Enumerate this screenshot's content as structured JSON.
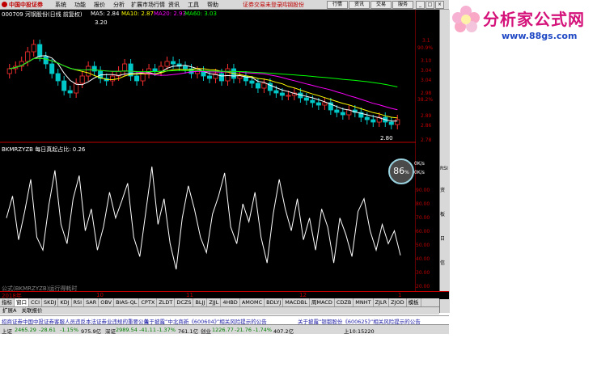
{
  "menubar": {
    "logo": "中国中投证券",
    "items": [
      "系统",
      "功能",
      "报价",
      "分析",
      "扩展市场行情",
      "资讯",
      "工具",
      "帮助"
    ],
    "notice": "证券交易未登录",
    "stock_link": "鸿钢股份",
    "buttons": [
      "行情",
      "资讯",
      "交易",
      "服务"
    ]
  },
  "main_info": {
    "code_name": "000709 河钢股份(日线 前复权)",
    "ma5": "MA5: 2.84",
    "ma10": "MA10: 2.87",
    "ma20": "MA20: 2.93",
    "ma60": "MA60: 3.03",
    "high_label": "3.20",
    "low_label": "2.80"
  },
  "price_axis": {
    "ticks": [
      "3.1",
      "90.9%",
      "3.10",
      "3.04",
      "3.04",
      "2.98",
      "38.2%",
      "2.89",
      "2.86",
      "2.78"
    ]
  },
  "indicator": {
    "title": "BKMRZYZB 每日真起占比: 0.26",
    "formula_label": "公式(BKMRZYZB)运行得耗时",
    "ticks": [
      "100.00",
      "90.00",
      "80.00",
      "70.00",
      "60.00",
      "50.00",
      "40.00",
      "30.00",
      "20.00",
      "10.00"
    ],
    "gauge_value": "86",
    "gauge_unit": "%",
    "net_up": "0K/s",
    "net_down": "0K/s",
    "month_labels": [
      "10",
      "11",
      "12"
    ],
    "year_label": "2018年",
    "last_label": "1"
  },
  "tab_bar": {
    "tabs": [
      "指标",
      "窗口",
      "CCI",
      "SKDJ",
      "KDJ",
      "RSI",
      "SAR",
      "OBV",
      "BIAS-QL",
      "CPTX",
      "ZLDT",
      "DCZS",
      "BLJJ",
      "ZJJL",
      "4HBD",
      "AMOMC",
      "BDLYJ",
      "MACDBL",
      "周MACD",
      "CDZB",
      "MNHT",
      "ZJLR",
      "ZJOD",
      "模板"
    ]
  },
  "subtab_bar": {
    "tabs": [
      "扩展A",
      "关联报价"
    ]
  },
  "news": [
    "招商证券中国中投证券客服人员违反本法证券业违规的重要公告",
    "关于披露“中北商新《600604》”相关风险提示的公告",
    "关于披露“银都股份《600625》”相关风险提示的公告"
  ],
  "status_bar": {
    "sh_label": "上证",
    "sh_value": "2465.29",
    "sh_change": "-28.61",
    "sh_pct": "-1.15%",
    "sh_amount": "975.9亿",
    "sz_label": "深证",
    "sz_value": "2989.54",
    "sz_change": "-41.11",
    "sz_pct": "-1.37%",
    "sz_amount": "761.1亿",
    "cy_label": "创业",
    "cy_value": "1226.77",
    "cy_change": "-21.76",
    "cy_pct": "-1.74%",
    "cy_amount": "407.2亿",
    "server": "上10:15220"
  },
  "right_strip": {
    "labels": [
      "RSI",
      "资",
      "板",
      "日",
      "信"
    ]
  },
  "watermark": {
    "text": "分析家公式网",
    "url": "www.88gs.com"
  },
  "colors": {
    "up": "#ff3030",
    "down": "#00c8c8",
    "ma5": "#ffffff",
    "ma10": "#ffff00",
    "ma20": "#ff00ff",
    "ma60": "#00ff00",
    "indicator_line": "#ffffff",
    "brand": "#d4127a",
    "url": "#1f48c4"
  },
  "chart_data": [
    {
      "type": "candlestick",
      "title": "000709 河钢股份(日线 前复权)",
      "ylim": [
        2.76,
        3.24
      ],
      "close": [
        3.05,
        3.06,
        3.08,
        3.12,
        3.15,
        3.1,
        3.07,
        3.03,
        3.0,
        2.96,
        2.95,
        2.99,
        3.02,
        3.06,
        3.04,
        3.01,
        3.0,
        3.02,
        3.04,
        3.07,
        3.02,
        3.0,
        3.03,
        3.05,
        3.04,
        3.06,
        3.08,
        3.07,
        3.06,
        3.05,
        3.03,
        3.04,
        3.02,
        3.01,
        3.03,
        3.0,
        3.05,
        3.01,
        3.02,
        3.0,
        2.99,
        2.97,
        2.99,
        2.96,
        2.95,
        2.94,
        2.94,
        2.95,
        2.93,
        2.92,
        2.91,
        2.9,
        2.91,
        2.88,
        2.87,
        2.86,
        2.88,
        2.87,
        2.85,
        2.84,
        2.83,
        2.85,
        2.83,
        2.82,
        2.84
      ],
      "ma_series": [
        {
          "name": "MA5",
          "value": 2.84
        },
        {
          "name": "MA10",
          "value": 2.87
        },
        {
          "name": "MA20",
          "value": 2.93
        },
        {
          "name": "MA60",
          "value": 3.03
        }
      ]
    },
    {
      "type": "line",
      "title": "BKMRZYZB 每日真起占比",
      "ylim": [
        0,
        100
      ],
      "series": [
        {
          "name": "BKMRZYZB",
          "values": [
            55,
            72,
            38,
            60,
            85,
            40,
            30,
            65,
            92,
            50,
            35,
            70,
            88,
            45,
            62,
            30,
            48,
            75,
            55,
            68,
            82,
            40,
            25,
            60,
            95,
            50,
            70,
            35,
            15,
            55,
            80,
            62,
            40,
            28,
            58,
            72,
            90,
            48,
            35,
            66,
            52,
            75,
            40,
            20,
            58,
            85,
            62,
            45,
            70,
            38,
            55,
            30,
            62,
            48,
            20,
            55,
            42,
            25,
            60,
            70,
            45,
            30,
            50,
            35,
            45,
            26
          ]
        }
      ]
    }
  ]
}
